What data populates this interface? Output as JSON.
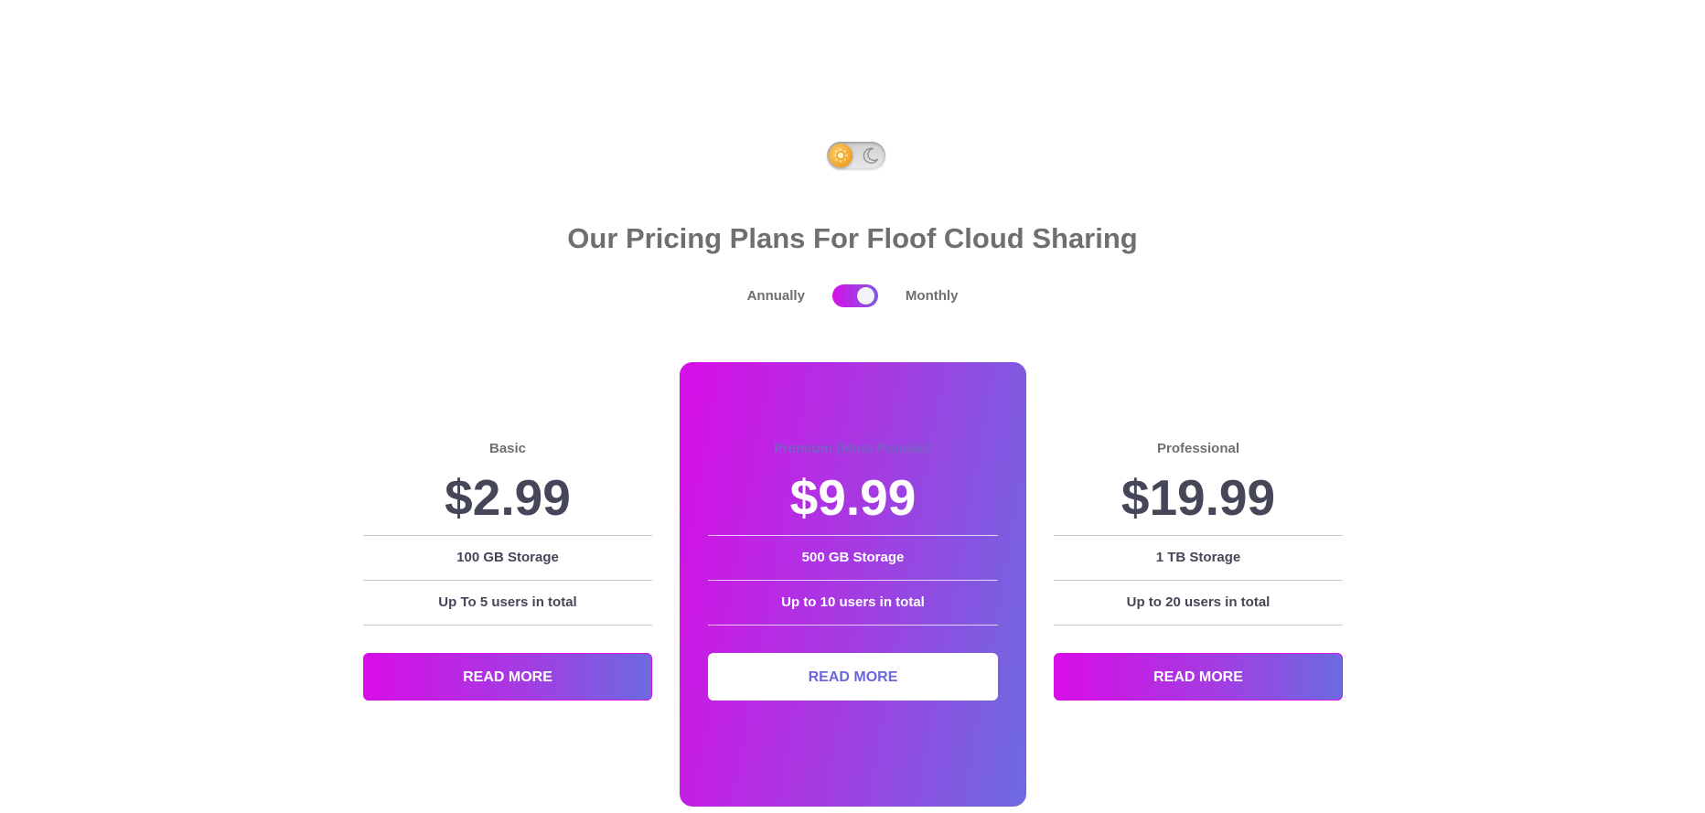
{
  "theme_toggle": {
    "mode": "light",
    "sun_icon": "sun-icon",
    "moon_icon": "moon-icon"
  },
  "header": {
    "title": "Our Pricing Plans For Floof Cloud Sharing"
  },
  "billing": {
    "left_label": "Annually",
    "right_label": "Monthly",
    "selected": "Monthly"
  },
  "plans": [
    {
      "name": "Basic",
      "price": "$2.99",
      "features": [
        "100 GB Storage",
        "Up To 5 users in total"
      ],
      "button": "READ MORE"
    },
    {
      "name": "Premium (Most Popular)",
      "price": "$9.99",
      "features": [
        "500 GB Storage",
        "Up to 10 users in total"
      ],
      "button": "READ MORE"
    },
    {
      "name": "Professional",
      "price": "$19.99",
      "features": [
        "1 TB Storage",
        "Up to 20 users in total"
      ],
      "button": "READ MORE"
    }
  ],
  "colors": {
    "gradient_start": "#d80de6",
    "gradient_end": "#6c6be0",
    "text_dark": "#454658",
    "text_muted": "#6f6f72"
  }
}
